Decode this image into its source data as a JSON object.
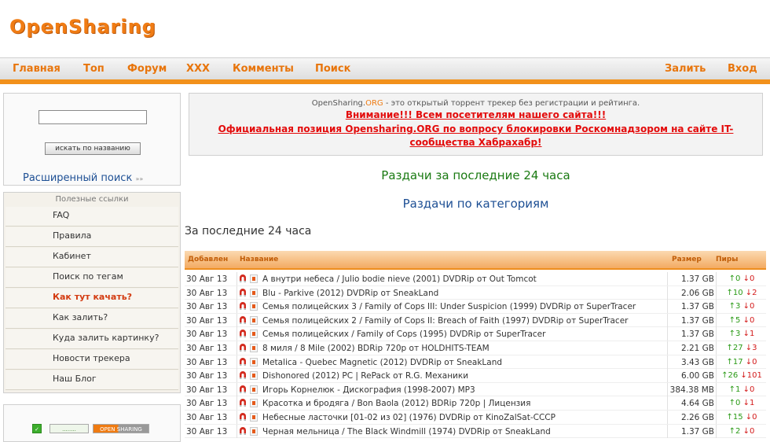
{
  "header": {
    "logo_text": "OpenSharing"
  },
  "nav": {
    "left": [
      "Главная",
      "Топ",
      "Форум",
      "XXX",
      "Комменты",
      "Поиск"
    ],
    "right": [
      "Залить",
      "Вход"
    ]
  },
  "search": {
    "input_value": "",
    "button_label": "искать по названию",
    "advanced_label": "Расширенный поиск",
    "advanced_arrow": "»»"
  },
  "links": {
    "title": "Полезные ссылки",
    "items": [
      "FAQ",
      "Правила",
      "Кабинет",
      "Поиск по тегам",
      "Как тут качать?",
      "Как залить?",
      "Куда залить картинку?",
      "Новости трекера",
      "Наш Блог"
    ]
  },
  "banners": {
    "first": "........",
    "second": "OPEN SHARING"
  },
  "notice": {
    "brand": "OpenSharing.",
    "org": "ORG",
    "line1_rest": " - это открытый торрент трекер без регистрации и рейтинга.",
    "line2": "Внимание!!! Всем посетителям нашего сайта!!!",
    "line3": "Официальная позиция Opensharing.ORG по вопросу блокировки Роскомнадзором на сайте IT-сообщества Хабрахабр!"
  },
  "main": {
    "recent_link": "Раздачи за последние 24 часа",
    "category_link": "Раздачи по категориям",
    "section_title": "За последние 24 часа"
  },
  "table": {
    "headers": {
      "date": "Добавлен",
      "title": "Название",
      "size": "Размер",
      "peers": "Пиры"
    },
    "rows": [
      {
        "date": "30 Авг 13",
        "title": "А внутри небеса / Julio bodie nieve (2001) DVDRip от Out Tomcot",
        "size": "1.37 GB",
        "seeds": "0",
        "leeches": "0"
      },
      {
        "date": "30 Авг 13",
        "title": "Blu - Parkive (2012) DVDRip от SneakLand",
        "size": "2.06 GB",
        "seeds": "10",
        "leeches": "2"
      },
      {
        "date": "30 Авг 13",
        "title": "Семья полицейских 3 / Family of Cops III: Under Suspicion (1999) DVDRip от SuperTracer",
        "size": "1.37 GB",
        "seeds": "3",
        "leeches": "0"
      },
      {
        "date": "30 Авг 13",
        "title": "Семья полицейских 2 / Family of Cops II: Breach of Faith (1997) DVDRip от SuperTracer",
        "size": "1.37 GB",
        "seeds": "5",
        "leeches": "0"
      },
      {
        "date": "30 Авг 13",
        "title": "Семья полицейских / Family of Cops (1995) DVDRip от SuperTracer",
        "size": "1.37 GB",
        "seeds": "3",
        "leeches": "1"
      },
      {
        "date": "30 Авг 13",
        "title": "8 миля / 8 Mile (2002) BDRip 720p от HOLDHITS-TEAM",
        "size": "2.21 GB",
        "seeds": "27",
        "leeches": "3"
      },
      {
        "date": "30 Авг 13",
        "title": "Metalica - Quebec Magnetic (2012) DVDRip от SneakLand",
        "size": "3.43 GB",
        "seeds": "17",
        "leeches": "0"
      },
      {
        "date": "30 Авг 13",
        "title": "Dishonored (2012) PC | RePack от R.G. Механики",
        "size": "6.00 GB",
        "seeds": "26",
        "leeches": "101"
      },
      {
        "date": "30 Авг 13",
        "title": "Игорь Корнелюк - Дискография (1998-2007) MP3",
        "size": "384.38 MB",
        "seeds": "1",
        "leeches": "0"
      },
      {
        "date": "30 Авг 13",
        "title": "Красотка и бродяга / Bon Baola (2012) BDRip 720p | Лицензия",
        "size": "4.64 GB",
        "seeds": "0",
        "leeches": "1"
      },
      {
        "date": "30 Авг 13",
        "title": "Небесные ласточки [01-02 из 02] (1976) DVDRip от KinoZalSat-CCCP",
        "size": "2.26 GB",
        "seeds": "15",
        "leeches": "0"
      },
      {
        "date": "30 Авг 13",
        "title": "Черная мельница / The Black Windmill (1974) DVDRip от SneakLand",
        "size": "1.37 GB",
        "seeds": "2",
        "leeches": "0"
      }
    ]
  },
  "colors": {
    "accent": "#f2911b",
    "link_blue": "#1d4f94",
    "link_green": "#1a7a12",
    "alert_red": "#e30b0b"
  },
  "icons": {
    "row_action": "magnet-icon",
    "row_category": "category-icon",
    "seed": "arrow-up-icon",
    "leech": "arrow-down-icon"
  }
}
